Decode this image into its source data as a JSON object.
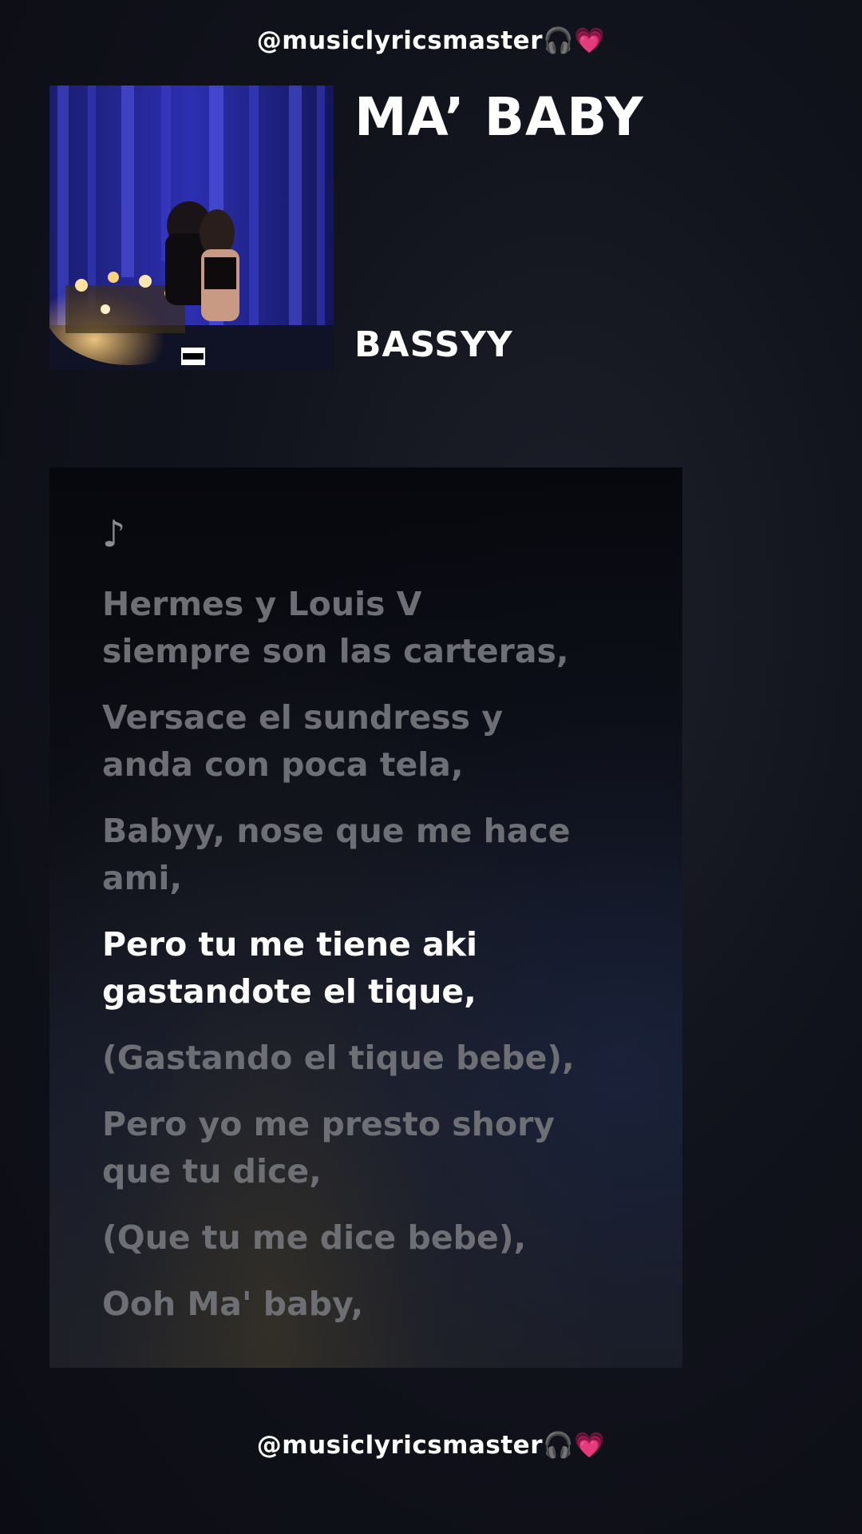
{
  "header": {
    "handle": "@musiclyricsmaster"
  },
  "footer": {
    "handle": "@musiclyricsmaster"
  },
  "song": {
    "title": "MA’ BABY",
    "artist": "BASSYY"
  },
  "icons": {
    "headphones": "headphones-icon",
    "heart": "pink-heart-icon",
    "note": "music-note-icon",
    "explicit": "parental-advisory-label"
  },
  "colors": {
    "background": "#0f1019",
    "active_lyric": "#ffffff",
    "inactive_lyric": "#6e6f74",
    "heart": "#ff2d9a"
  },
  "lyrics": [
    {
      "text": "Hermes y Louis V\nsiempre son las carteras,",
      "active": false
    },
    {
      "text": "Versace el sundress y\nanda con poca tela,",
      "active": false
    },
    {
      "text": "Babyy, nose que me hace\nami,",
      "active": false
    },
    {
      "text": "Pero tu me tiene aki\ngastandote el tique,",
      "active": true
    },
    {
      "text": "(Gastando el tique bebe),",
      "active": false
    },
    {
      "text": "Pero yo me presto shory\nque tu dice,",
      "active": false
    },
    {
      "text": "(Que tu me dice bebe),",
      "active": false
    },
    {
      "text": "Ooh Ma' baby,",
      "active": false
    }
  ]
}
